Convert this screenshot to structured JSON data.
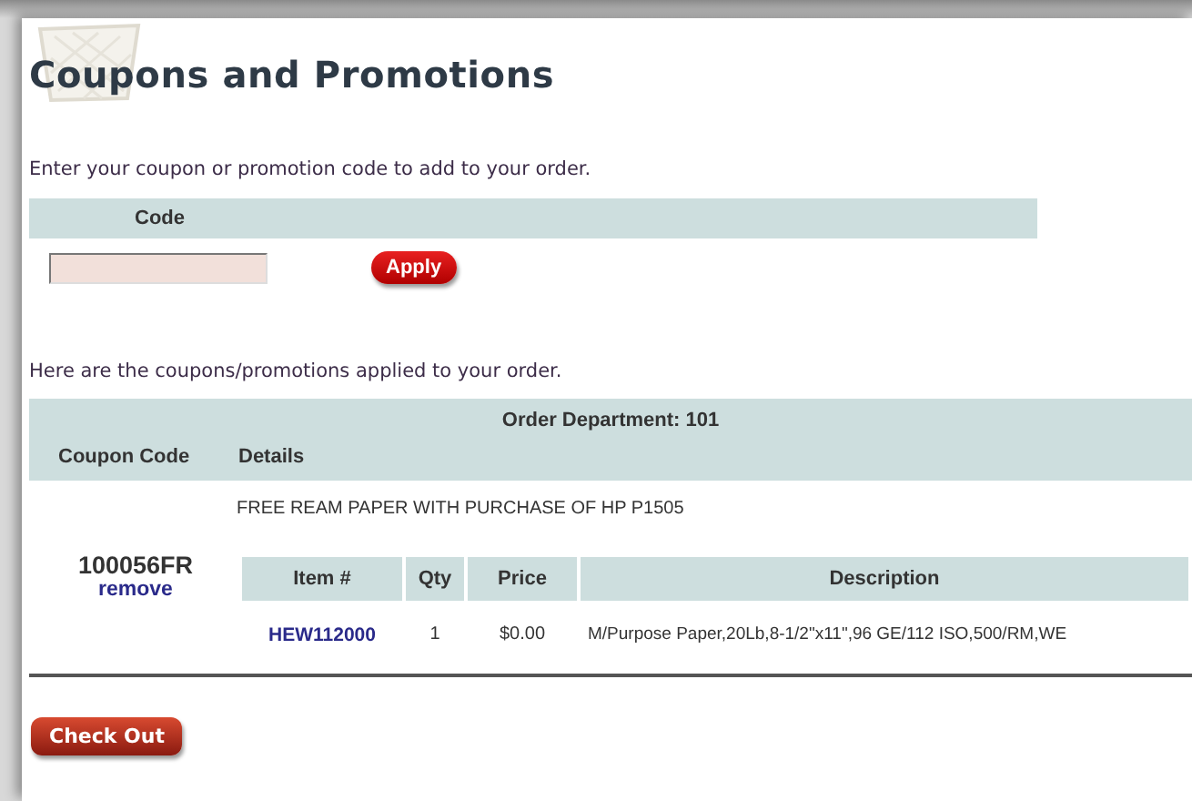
{
  "title": "Coupons and Promotions",
  "entry": {
    "prompt": "Enter your coupon or promotion code to add to your order.",
    "column": "Code",
    "button": "Apply"
  },
  "applied": {
    "prompt": "Here are the coupons/promotions applied to your order.",
    "department": "Order Department: 101",
    "columns": [
      "Coupon Code",
      "Details"
    ],
    "coupons": [
      {
        "code": "100056FR",
        "remove": "remove",
        "details": "FREE REAM PAPER WITH PURCHASE OF HP P1505",
        "item_columns": [
          "Item #",
          "Qty",
          "Price",
          "Description"
        ],
        "items": [
          {
            "item": "HEW112000",
            "qty": "1",
            "price": "$0.00",
            "description": "M/Purpose Paper,20Lb,8-1/2\"x11\",96 GE/112 ISO,500/RM,WE"
          }
        ]
      }
    ]
  },
  "checkout": "Check Out"
}
